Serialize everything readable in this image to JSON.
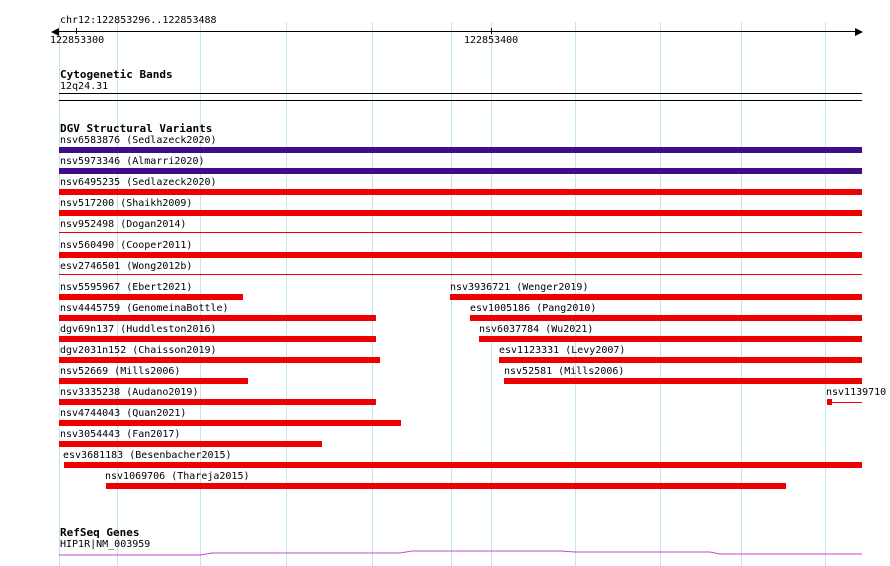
{
  "ruler": {
    "locus": "chr12:122853296..122853488",
    "tick_labels": [
      "122853300",
      "122853400"
    ]
  },
  "tracks": {
    "cytoband": {
      "title": "Cytogenetic Bands",
      "band": "12q24.31"
    },
    "dgv": {
      "title": "DGV Structural Variants",
      "features": [
        {
          "label": "nsv6583876 (Sedlazeck2020)",
          "color": "#3f0d8a"
        },
        {
          "label": "nsv5973346 (Almarri2020)",
          "color": "#3f0d8a"
        },
        {
          "label": "nsv6495235 (Sedlazeck2020)",
          "color": "#ee0000"
        },
        {
          "label": "nsv517200 (Shaikh2009)",
          "color": "#ee0000"
        },
        {
          "label": "nsv952498 (Dogan2014)",
          "color": "#ee0000"
        },
        {
          "label": "nsv560490 (Cooper2011)",
          "color": "#ee0000"
        },
        {
          "label": "esv2746501 (Wong2012b)",
          "color": "#ee0000"
        },
        {
          "label": "nsv5595967 (Ebert2021)",
          "color": "#ee0000"
        },
        {
          "label": "nsv3936721 (Wenger2019)",
          "color": "#ee0000"
        },
        {
          "label": "nsv4445759 (GenomeinaBottle)",
          "color": "#ee0000"
        },
        {
          "label": "esv1005186 (Pang2010)",
          "color": "#ee0000"
        },
        {
          "label": "dgv69n137 (Huddleston2016)",
          "color": "#ee0000"
        },
        {
          "label": "nsv6037784 (Wu2021)",
          "color": "#ee0000"
        },
        {
          "label": "dgv2031n152 (Chaisson2019)",
          "color": "#ee0000"
        },
        {
          "label": "esv1123331 (Levy2007)",
          "color": "#ee0000"
        },
        {
          "label": "nsv52669 (Mills2006)",
          "color": "#ee0000"
        },
        {
          "label": "nsv52581 (Mills2006)",
          "color": "#ee0000"
        },
        {
          "label": "nsv3335238 (Audano2019)",
          "color": "#ee0000"
        },
        {
          "label": "nsv1139710",
          "color": "#ee0000"
        },
        {
          "label": "nsv4744043 (Quan2021)",
          "color": "#ee0000"
        },
        {
          "label": "nsv3054443 (Fan2017)",
          "color": "#ee0000"
        },
        {
          "label": "esv3681183 (Besenbacher2015)",
          "color": "#ee0000"
        },
        {
          "label": "nsv1069706 (Thareja2015)",
          "color": "#ee0000"
        }
      ]
    },
    "refseq": {
      "title": "RefSeq Genes",
      "gene": "HIP1R|NM_003959",
      "color": "#cc44cc"
    }
  }
}
